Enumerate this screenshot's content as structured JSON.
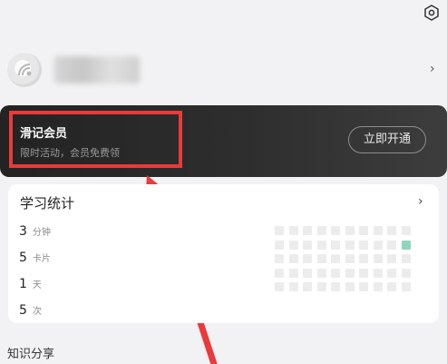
{
  "header": {
    "settings_icon": "hexagon-gear-icon"
  },
  "profile": {
    "avatar_icon": "avatar-logo",
    "chevron": "›"
  },
  "vip": {
    "title": "滑记会员",
    "subtitle": "限时活动，会员免费领",
    "button_label": "立即开通"
  },
  "stats": {
    "title": "学习统计",
    "chevron": "›",
    "rows": [
      {
        "value": "3",
        "unit": "分钟"
      },
      {
        "value": "5",
        "unit": "卡片"
      },
      {
        "value": "1",
        "unit": "天"
      },
      {
        "value": "5",
        "unit": "次"
      }
    ],
    "heatmap": {
      "rows": 5,
      "cols": 10,
      "highlight": [
        {
          "row": 1,
          "col": 9
        }
      ],
      "active_color": "#8fd4bd",
      "empty_color": "#ececec"
    }
  },
  "section": {
    "title": "知识分享"
  },
  "annotation": {
    "color": "#ea3a3a"
  }
}
